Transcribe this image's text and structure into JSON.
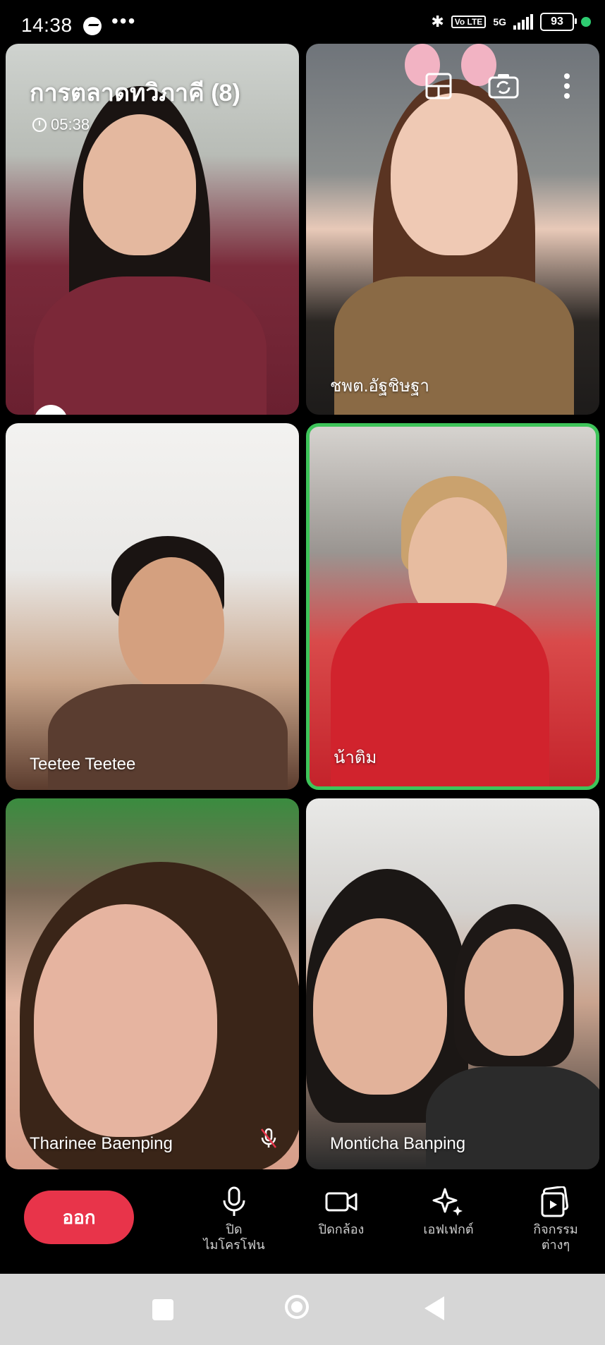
{
  "status_bar": {
    "time": "14:38",
    "dots": "•••",
    "volte": "Vo LTE",
    "network": "5G",
    "battery": "93"
  },
  "meeting": {
    "title": "การตลาดทวิภาคี  (8)",
    "timer": "05:38"
  },
  "tiles": [
    {
      "name": ""
    },
    {
      "name": "ชพต.อัฐชิษฐา"
    },
    {
      "name": "Teetee Teetee"
    },
    {
      "name": "น้าติม"
    },
    {
      "name": "Tharinee Baenping"
    },
    {
      "name": "Monticha Banping"
    }
  ],
  "controls": {
    "leave": "ออก",
    "mic": "ปิด\nไมโครโฟน",
    "camera": "ปิดกล้อง",
    "effects": "เอฟเฟกต์",
    "activities": "กิจกรรม\nต่างๆ"
  },
  "colors": {
    "leave_button": "#e8344a",
    "active_speaker_border": "#3ec45a"
  }
}
